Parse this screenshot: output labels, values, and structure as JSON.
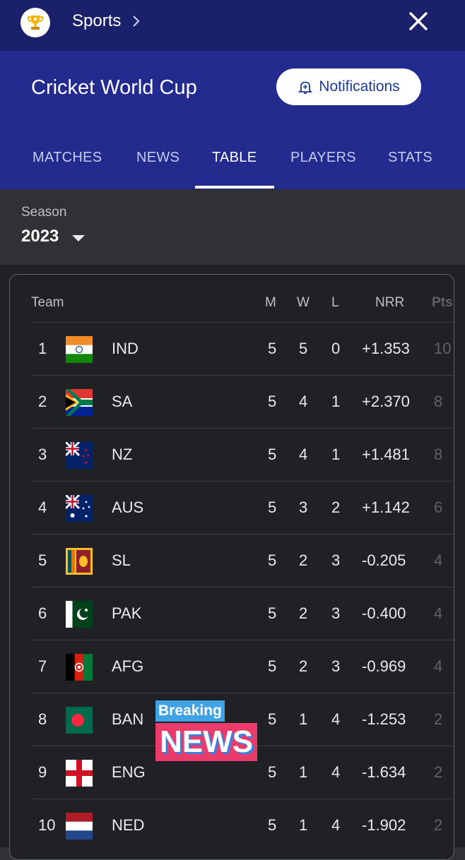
{
  "header": {
    "breadcrumb_label": "Sports",
    "title": "Cricket World Cup",
    "notifications_label": "Notifications"
  },
  "tabs": [
    "MATCHES",
    "NEWS",
    "TABLE",
    "PLAYERS",
    "STATS"
  ],
  "active_tab": "TABLE",
  "season": {
    "label": "Season",
    "value": "2023"
  },
  "table": {
    "headers": {
      "team": "Team",
      "m": "M",
      "w": "W",
      "l": "L",
      "nrr": "NRR",
      "pts": "Pts"
    },
    "rows": [
      {
        "rank": "1",
        "team": "IND",
        "m": "5",
        "w": "5",
        "l": "0",
        "nrr": "+1.353",
        "pts": "10"
      },
      {
        "rank": "2",
        "team": "SA",
        "m": "5",
        "w": "4",
        "l": "1",
        "nrr": "+2.370",
        "pts": "8"
      },
      {
        "rank": "3",
        "team": "NZ",
        "m": "5",
        "w": "4",
        "l": "1",
        "nrr": "+1.481",
        "pts": "8"
      },
      {
        "rank": "4",
        "team": "AUS",
        "m": "5",
        "w": "3",
        "l": "2",
        "nrr": "+1.142",
        "pts": "6"
      },
      {
        "rank": "5",
        "team": "SL",
        "m": "5",
        "w": "2",
        "l": "3",
        "nrr": "-0.205",
        "pts": "4"
      },
      {
        "rank": "6",
        "team": "PAK",
        "m": "5",
        "w": "2",
        "l": "3",
        "nrr": "-0.400",
        "pts": "4"
      },
      {
        "rank": "7",
        "team": "AFG",
        "m": "5",
        "w": "2",
        "l": "3",
        "nrr": "-0.969",
        "pts": "4"
      },
      {
        "rank": "8",
        "team": "BAN",
        "m": "5",
        "w": "1",
        "l": "4",
        "nrr": "-1.253",
        "pts": "2"
      },
      {
        "rank": "9",
        "team": "ENG",
        "m": "5",
        "w": "1",
        "l": "4",
        "nrr": "-1.634",
        "pts": "2"
      },
      {
        "rank": "10",
        "team": "NED",
        "m": "5",
        "w": "1",
        "l": "4",
        "nrr": "-1.902",
        "pts": "2"
      }
    ]
  },
  "overlay": {
    "line1": "Breaking",
    "line2": "NEWS"
  },
  "colors": {
    "topbar": "#1a2069",
    "hero": "#232b8e",
    "table_bg": "#202124",
    "accent": "#1a3a9c"
  }
}
